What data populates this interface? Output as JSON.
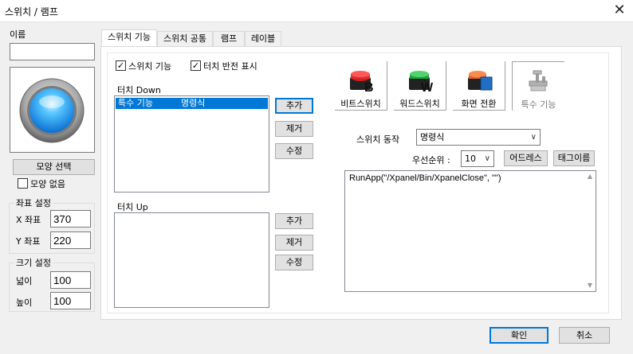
{
  "window": {
    "title": "스위치 / 램프"
  },
  "left": {
    "name_label": "이름",
    "name_value": "",
    "shape_select_label": "모양 선택",
    "no_shape_label": "모양 없음",
    "no_shape_checked": false,
    "coord_group": "좌표 설정",
    "x_label": "X 좌표",
    "x_value": "370",
    "y_label": "Y 좌표",
    "y_value": "220",
    "size_group": "크기 설정",
    "width_label": "넓이",
    "width_value": "100",
    "height_label": "높이",
    "height_value": "100"
  },
  "tabs": [
    "스위치 기능",
    "스위치 공통",
    "램프",
    "레이블"
  ],
  "active_tab": 0,
  "switch_tab": {
    "switch_func_label": "스위치 기능",
    "switch_func_checked": true,
    "touch_invert_label": "터치 반전 표시",
    "touch_invert_checked": true,
    "touch_down_label": "터치 Down",
    "touch_down_rows": [
      {
        "col1": "특수 기능",
        "col2": "명령식",
        "selected": true
      }
    ],
    "touch_up_label": "터치 Up",
    "add_label": "추가",
    "remove_label": "제거",
    "edit_label": "수정",
    "tools": [
      {
        "label": "비트스위치",
        "icon": "bit-switch-icon"
      },
      {
        "label": "워드스위치",
        "icon": "word-switch-icon"
      },
      {
        "label": "화면 전환",
        "icon": "screen-change-icon"
      },
      {
        "label": "특수 기능",
        "icon": "special-function-icon"
      }
    ],
    "action_label": "스위치 동작",
    "action_value": "명령식",
    "priority_label": "우선순위 :",
    "priority_value": "10",
    "address_button": "어드레스",
    "tagname_button": "태그이름",
    "script_text": "RunApp(\"/Xpanel/Bin/XpanelClose\", \"\")"
  },
  "footer": {
    "ok_label": "확인",
    "cancel_label": "취소"
  },
  "colors": {
    "accent": "#0078d7",
    "selection": "#0078d7"
  }
}
